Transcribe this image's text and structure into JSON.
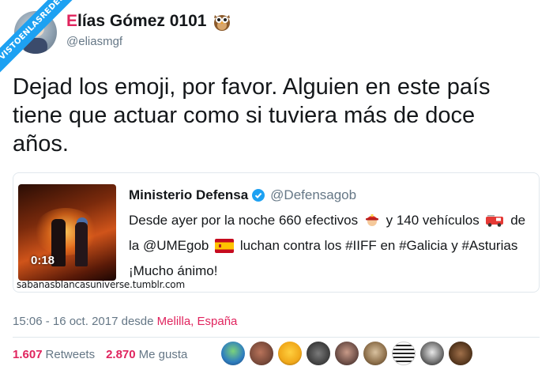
{
  "watermark": "VISTOENLASREDES",
  "author": {
    "initial": "E",
    "name_rest": "lías Gómez 0101",
    "handle": "@eliasmgf",
    "badge_icon": "owl-emoji"
  },
  "tweet": {
    "text": "Dejad los emoji, por favor. Alguien en este país tiene que actuar como si tuviera más de doce años."
  },
  "quoted": {
    "name": "Ministerio Defensa",
    "handle": "@Defensagob",
    "video_duration": "0:18",
    "source_caption": "sabanasblancasuniverse.tumblr.com",
    "line1_a": "Desde ayer por la noche 660 efectivos",
    "line1_b": "y 140 vehículos",
    "line1_c": "de",
    "line2_a": "la @UMEgob",
    "line2_b": "luchan contra los #IIFF en #Galicia y #Asturias",
    "line3": "¡Mucho ánimo!",
    "icons": [
      "verified-icon",
      "firefighter-emoji",
      "fire-engine-emoji",
      "spain-flag-emoji"
    ]
  },
  "meta": {
    "time": "15:06 - 16 oct. 2017 desde",
    "location": "Melilla, España"
  },
  "stats": {
    "retweets_count": "1.607",
    "retweets_label": "Retweets",
    "likes_count": "2.870",
    "likes_label": "Me gusta"
  },
  "colors": {
    "accent": "#e0245e",
    "muted": "#657786",
    "twitter_blue": "#1da1f2"
  }
}
